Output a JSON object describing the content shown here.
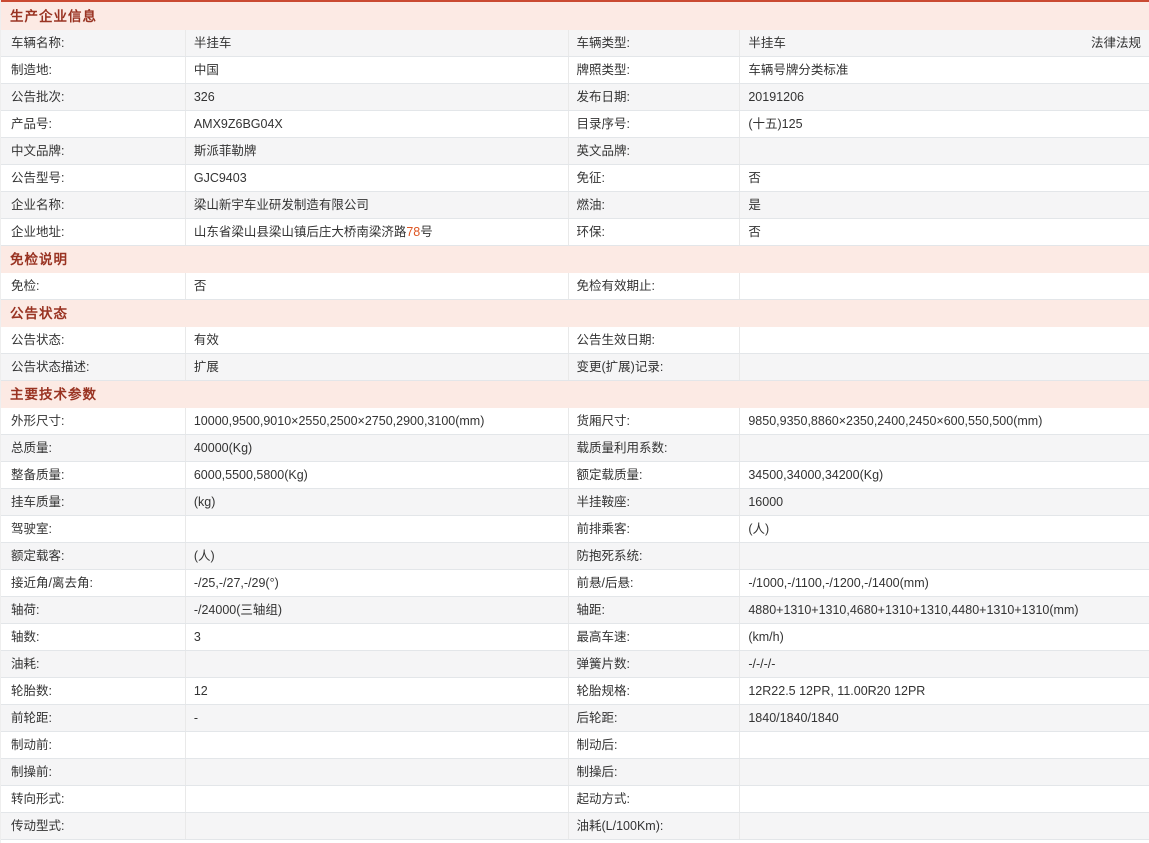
{
  "colors": {
    "top_line": "#ca4a32",
    "header_bg": "#fceae4",
    "header_text": "#993322",
    "stripe": "#f5f5f6",
    "border": "#e3e6e9",
    "vborder": "#e9e9e9",
    "text": "#333333",
    "highlight": "#dd5522",
    "link": "#333333"
  },
  "legal_link": "法律法规",
  "sections": [
    {
      "title": "生产企业信息",
      "rows": [
        {
          "ll": "车辆名称:",
          "lv": "半挂车",
          "rl": "车辆类型:",
          "rv": "半挂车",
          "stripe": true,
          "legal": true
        },
        {
          "ll": "制造地:",
          "lv": "中国",
          "rl": "牌照类型:",
          "rv": "车辆号牌分类标准",
          "stripe": false
        },
        {
          "ll": "公告批次:",
          "lv": "326",
          "rl": "发布日期:",
          "rv": "20191206",
          "stripe": true
        },
        {
          "ll": "产品号:",
          "lv": "AMX9Z6BG04X",
          "rl": "目录序号:",
          "rv": "(十五)125",
          "stripe": false
        },
        {
          "ll": "中文品牌:",
          "lv": "斯派菲勒牌",
          "rl": "英文品牌:",
          "rv": "",
          "stripe": true
        },
        {
          "ll": "公告型号:",
          "lv": "GJC9403",
          "rl": "免征:",
          "rv": "否",
          "stripe": false
        },
        {
          "ll": "企业名称:",
          "lv": "梁山新宇车业研发制造有限公司",
          "rl": "燃油:",
          "rv": "是",
          "stripe": true
        },
        {
          "ll": "企业地址:",
          "lv": "山东省梁山县梁山镇后庄大桥南梁济路78号",
          "hl": "78",
          "rl": "环保:",
          "rv": "否",
          "stripe": false
        }
      ]
    },
    {
      "title": "免检说明",
      "rows": [
        {
          "ll": "免检:",
          "lv": "否",
          "rl": "免检有效期止:",
          "rv": "",
          "stripe": false
        }
      ]
    },
    {
      "title": "公告状态",
      "rows": [
        {
          "ll": "公告状态:",
          "lv": "有效",
          "rl": "公告生效日期:",
          "rv": "",
          "stripe": false
        },
        {
          "ll": "公告状态描述:",
          "lv": "扩展",
          "rl": "变更(扩展)记录:",
          "rv": "",
          "stripe": true
        }
      ]
    },
    {
      "title": "主要技术参数",
      "rows": [
        {
          "ll": "外形尺寸:",
          "lv": "10000,9500,9010×2550,2500×2750,2900,3100(mm)",
          "rl": "货厢尺寸:",
          "rv": "9850,9350,8860×2350,2400,2450×600,550,500(mm)",
          "stripe": false
        },
        {
          "ll": "总质量:",
          "lv": "40000(Kg)",
          "rl": "载质量利用系数:",
          "rv": "",
          "stripe": true
        },
        {
          "ll": "整备质量:",
          "lv": "6000,5500,5800(Kg)",
          "rl": "额定载质量:",
          "rv": "34500,34000,34200(Kg)",
          "stripe": false
        },
        {
          "ll": "挂车质量:",
          "lv": "(kg)",
          "rl": "半挂鞍座:",
          "rv": "16000",
          "stripe": true
        },
        {
          "ll": "驾驶室:",
          "lv": "",
          "rl": "前排乘客:",
          "rv": "(人)",
          "stripe": false
        },
        {
          "ll": "额定载客:",
          "lv": "(人)",
          "rl": "防抱死系统:",
          "rv": "",
          "stripe": true
        },
        {
          "ll": "接近角/离去角:",
          "lv": "-/25,-/27,-/29(°)",
          "rl": "前悬/后悬:",
          "rv": "-/1000,-/1100,-/1200,-/1400(mm)",
          "stripe": false
        },
        {
          "ll": "轴荷:",
          "lv": "-/24000(三轴组)",
          "rl": "轴距:",
          "rv": "4880+1310+1310,4680+1310+1310,4480+1310+1310(mm)",
          "stripe": true
        },
        {
          "ll": "轴数:",
          "lv": "3",
          "rl": "最高车速:",
          "rv": "(km/h)",
          "stripe": false
        },
        {
          "ll": "油耗:",
          "lv": "",
          "rl": "弹簧片数:",
          "rv": "-/-/-/-",
          "stripe": true
        },
        {
          "ll": "轮胎数:",
          "lv": "12",
          "rl": "轮胎规格:",
          "rv": "12R22.5 12PR, 11.00R20 12PR",
          "stripe": false
        },
        {
          "ll": "前轮距:",
          "lv": "-",
          "rl": "后轮距:",
          "rv": "1840/1840/1840",
          "stripe": true
        },
        {
          "ll": "制动前:",
          "lv": "",
          "rl": "制动后:",
          "rv": "",
          "stripe": false
        },
        {
          "ll": "制操前:",
          "lv": "",
          "rl": "制操后:",
          "rv": "",
          "stripe": true
        },
        {
          "ll": "转向形式:",
          "lv": "",
          "rl": "起动方式:",
          "rv": "",
          "stripe": false
        },
        {
          "ll": "传动型式:",
          "lv": "",
          "rl": "油耗(L/100Km):",
          "rv": "",
          "stripe": true
        }
      ]
    }
  ]
}
